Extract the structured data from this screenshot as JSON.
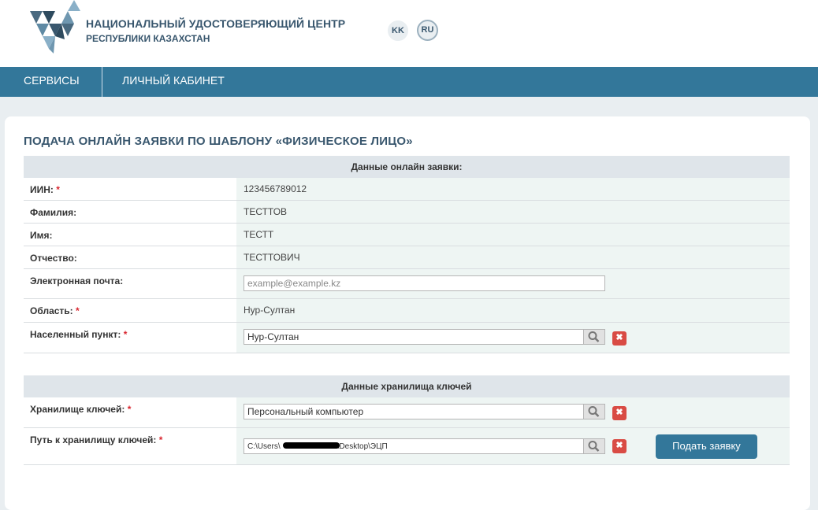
{
  "header": {
    "org_title": "НАЦИОНАЛЬНЫЙ УДОСТОВЕРЯЮЩИЙ ЦЕНТР",
    "org_subtitle": "РЕСПУБЛИКИ КАЗАХСТАН",
    "lang_kk": "KK",
    "lang_ru": "RU",
    "active_lang": "RU"
  },
  "nav": {
    "services": "СЕРВИСЫ",
    "cabinet": "ЛИЧНЫЙ КАБИНЕТ"
  },
  "form": {
    "title": "ПОДАЧА ОНЛАЙН ЗАЯВКИ ПО ШАБЛОНУ «ФИЗИЧЕСКОЕ ЛИЦО»",
    "section1_title": "Данные онлайн заявки:",
    "iin_label": "ИИН:",
    "iin_value": "123456789012",
    "surname_label": "Фамилия:",
    "surname_value": "ТЕСТТОВ",
    "name_label": "Имя:",
    "name_value": "ТЕСТТ",
    "patronymic_label": "Отчество:",
    "patronymic_value": "ТЕСТТОВИЧ",
    "email_label": "Электронная почта:",
    "email_placeholder": "example@example.kz",
    "region_label": "Область:",
    "region_value": "Нур-Султан",
    "locality_label": "Населенный пункт:",
    "locality_value": "Нур-Султан",
    "required_mark": "*",
    "section2_title": "Данные хранилища ключей",
    "storage_label": "Хранилище ключей:",
    "storage_value": "Персональный компьютер",
    "path_label": "Путь к хранилищу ключей:",
    "path_prefix": "C:\\Users\\",
    "path_suffix": "\\Desktop\\ЭЦП",
    "clear_glyph": "✖",
    "submit_label": "Подать заявку"
  },
  "colors": {
    "accent": "#33779a",
    "title_text": "#39576e",
    "danger": "#d94b44",
    "required_star": "#d9262f"
  }
}
